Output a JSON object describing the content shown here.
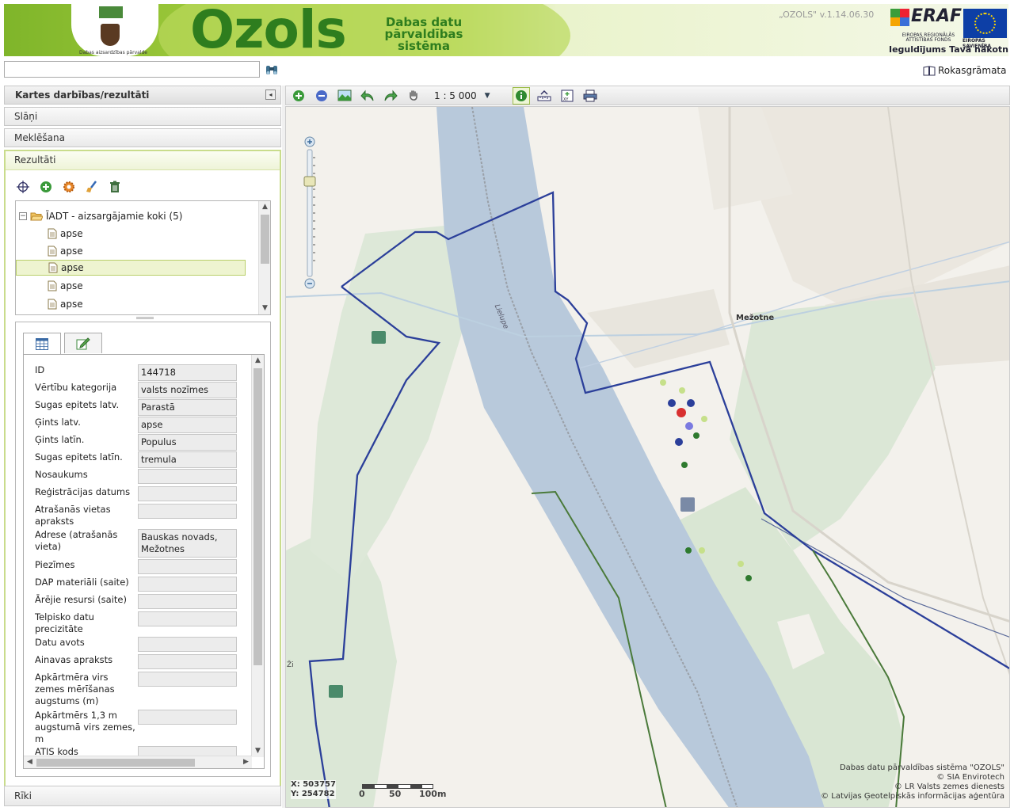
{
  "header": {
    "logo_caption": "Dabas aizsardzības pārvalde",
    "brand_title": "Ozols",
    "brand_subtitle": "Dabas datu pārvaldības sistēma",
    "version": "„OZOLS\" v.1.14.06.30",
    "eraf_title": "ERAF",
    "eraf_subtitle": "EIROPAS REĢIONĀLĀS ATTĪSTĪBAS FONDS",
    "investment_slogan": "Ieguldījums Tavā nākotnē!",
    "eu_caption": "EIROPAS SAVIENĪBA"
  },
  "search": {
    "value": "",
    "placeholder": ""
  },
  "manual_link": "Rokasgrāmata",
  "left_panel": {
    "title": "Kartes darbības/rezultāti",
    "sections": [
      "Slāņi",
      "Meklēšana"
    ],
    "results_title": "Rezultāti",
    "tools_title": "Rīki"
  },
  "results_toolbar": [
    {
      "name": "locate-icon"
    },
    {
      "name": "add-icon"
    },
    {
      "name": "settings-icon"
    },
    {
      "name": "clear-icon"
    },
    {
      "name": "delete-icon"
    }
  ],
  "tree": {
    "group": "ĪADT - aizsargājamie koki (5)",
    "items": [
      "apse",
      "apse",
      "apse",
      "apse",
      "apse"
    ],
    "selected_index": 2
  },
  "attributes": [
    {
      "label": "ID",
      "value": "144718"
    },
    {
      "label": "Vērtību kategorija",
      "value": "valsts nozīmes"
    },
    {
      "label": "Sugas epitets latv.",
      "value": "Parastā"
    },
    {
      "label": "Ģints latv.",
      "value": "apse"
    },
    {
      "label": "Ģints latīn.",
      "value": "Populus"
    },
    {
      "label": "Sugas epitets latīn.",
      "value": "tremula"
    },
    {
      "label": "Nosaukums",
      "value": ""
    },
    {
      "label": "Reģistrācijas datums",
      "value": ""
    },
    {
      "label": "Atrašanās vietas apraksts",
      "value": ""
    },
    {
      "label": "Adrese (atrašanās vieta)",
      "value": "Bauskas novads, Mežotnes"
    },
    {
      "label": "Piezīmes",
      "value": ""
    },
    {
      "label": "DAP materiāli (saite)",
      "value": ""
    },
    {
      "label": "Ārējie resursi (saite)",
      "value": ""
    },
    {
      "label": "Telpisko datu precizitāte",
      "value": ""
    },
    {
      "label": "Datu avots",
      "value": ""
    },
    {
      "label": "Ainavas apraksts",
      "value": ""
    },
    {
      "label": "Apkārtmēra virs zemes mērīšanas augstums (m)",
      "value": ""
    },
    {
      "label": "Apkārtmērs 1,3 m augstumā virs zemes, m",
      "value": ""
    },
    {
      "label": "ATIS kods",
      "value": ""
    }
  ],
  "map": {
    "scale": "1 : 5 000",
    "river_label": "Lielupe",
    "place_label": "Mežotne",
    "edge_label": "Ži",
    "coord_x": "X: 503757",
    "coord_y": "Y: 254782",
    "scalebar_labels": [
      "0",
      "50",
      "100m"
    ],
    "credits": [
      "Dabas datu pārvaldības sistēma \"OZOLS\"",
      "© SIA Envirotech",
      "© LR Valsts zemes dienests",
      "© Latvijas Ģeotelpiskās informācijas aģentūra"
    ]
  },
  "colors": {
    "brand_green": "#2e7d1e",
    "river": "#b7c9dc",
    "boundary": "#2b3f9a",
    "forest": "#d9e6d3"
  }
}
